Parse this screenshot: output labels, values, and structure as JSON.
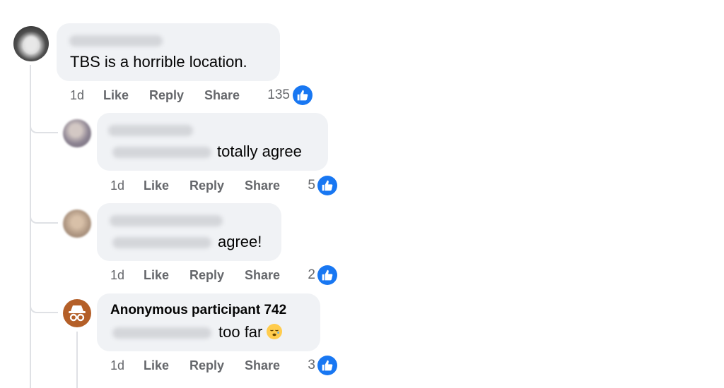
{
  "comments": [
    {
      "text": "TBS is a horrible location.",
      "age": "1d",
      "like_label": "Like",
      "reply_label": "Reply",
      "share_label": "Share",
      "reactions": "135"
    },
    {
      "text": "totally agree",
      "age": "1d",
      "like_label": "Like",
      "reply_label": "Reply",
      "share_label": "Share",
      "reactions": "5"
    },
    {
      "text": "agree!",
      "age": "1d",
      "like_label": "Like",
      "reply_label": "Reply",
      "share_label": "Share",
      "reactions": "2"
    },
    {
      "author": "Anonymous participant 742",
      "text": "too far",
      "emoji": "sleepy-face-emoji",
      "age": "1d",
      "like_label": "Like",
      "reply_label": "Reply",
      "share_label": "Share",
      "reactions": "3"
    }
  ],
  "colors": {
    "bubble": "#f0f2f5",
    "action_text": "#65676b",
    "like_blue": "#1877f2",
    "thread_line": "#dfe1e5",
    "anonymous_avatar": "#b45f28"
  }
}
